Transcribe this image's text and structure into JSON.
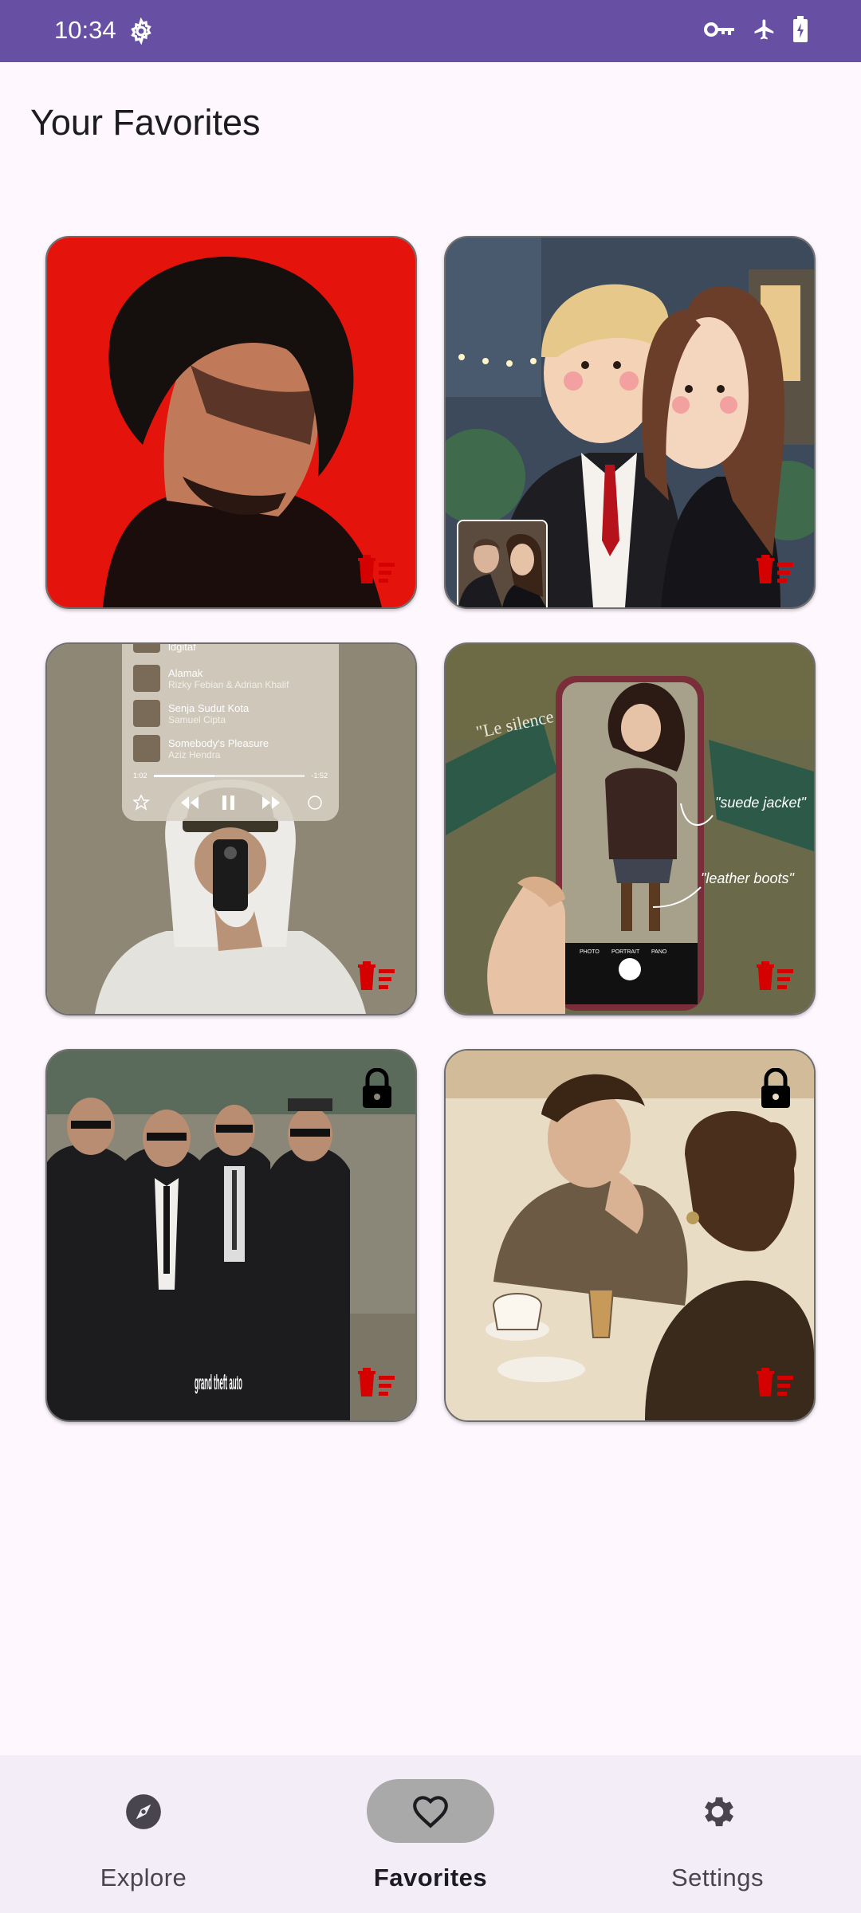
{
  "status_bar": {
    "time": "10:34",
    "icons": [
      "gear-icon",
      "vpn-key-icon",
      "airplane-mode-icon",
      "battery-charging-icon"
    ]
  },
  "page": {
    "title": "Your Favorites"
  },
  "favorites": [
    {
      "name": "portrait-red-background",
      "locked": false,
      "has_thumbnail": false
    },
    {
      "name": "cartoon-couple-city",
      "locked": false,
      "has_thumbnail": true
    },
    {
      "name": "hoodie-selfie-music",
      "locked": false,
      "has_thumbnail": false,
      "music": {
        "top": "ldgitaf",
        "tracks": [
          {
            "title": "Alamak",
            "artist": "Rizky Febian & Adrian Khalif"
          },
          {
            "title": "Senja Sudut Kota",
            "artist": "Samuel Cipta"
          },
          {
            "title": "Somebody's Pleasure",
            "artist": "Aziz Hendra"
          }
        ],
        "elapsed": "1:02",
        "remaining": "-1:52"
      }
    },
    {
      "name": "phone-photo-fashion",
      "locked": false,
      "has_thumbnail": false,
      "annotations": [
        "\"suede jacket\"",
        "\"leather boots\""
      ],
      "camera_modes": [
        "PHOTO",
        "PORTRAIT",
        "PANO"
      ],
      "sign_text": "\"Le silence"
    },
    {
      "name": "gta-suits-group",
      "locked": true,
      "has_thumbnail": false,
      "logo_text": "grand theft auto"
    },
    {
      "name": "watercolor-cafe-couple",
      "locked": true,
      "has_thumbnail": false
    }
  ],
  "colors": {
    "status_bar": "#6750A4",
    "background": "#FEF7FE",
    "delete": "#D50000",
    "nav_bg": "#F3EDF7",
    "nav_active": "#A9A9A9"
  },
  "nav": {
    "explore": "Explore",
    "favorites": "Favorites",
    "settings": "Settings",
    "active": "favorites"
  }
}
